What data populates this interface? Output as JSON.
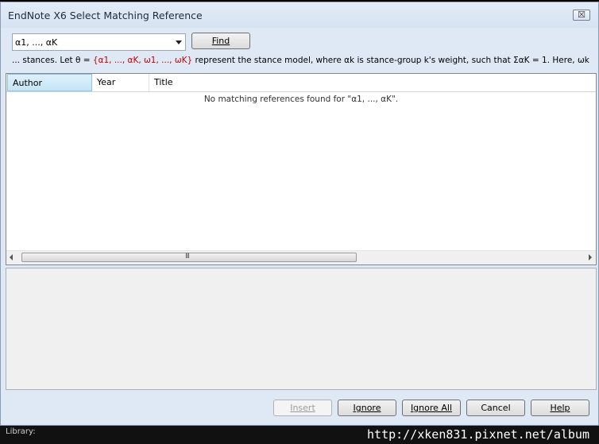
{
  "window": {
    "title": "EndNote X6 Select Matching Reference",
    "close_glyph": "☒"
  },
  "search": {
    "value": "α1, ..., αK",
    "find_label": "Find"
  },
  "context": {
    "before": "... stances. Let θ = ",
    "highlight": "{α1, ..., αK, ω1, ..., ωK}",
    "after": " represent the stance model, where αk is stance-group k's weight, such that ΣαK = 1. Here, ωk is an N-dime"
  },
  "list": {
    "columns": [
      "Author",
      "Year",
      "Title"
    ],
    "empty_message": "No matching references found for \"α1, ..., αK\".",
    "scroll_grip": "III"
  },
  "buttons": {
    "insert": "Insert",
    "ignore": "Ignore",
    "ignore_all": "Ignore All",
    "cancel": "Cancel",
    "help": "Help"
  },
  "status": {
    "library_label": "Library:"
  },
  "watermark": "http://xken831.pixnet.net/album",
  "colors": {
    "highlight": "#c00000",
    "window_bg": "#dfe9f5"
  }
}
